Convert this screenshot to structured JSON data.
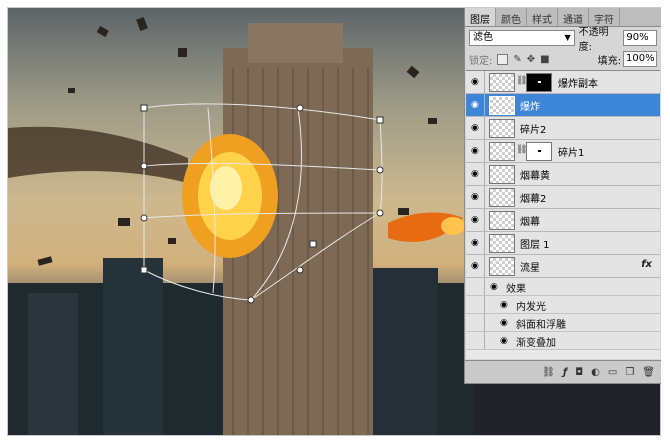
{
  "panel": {
    "tabs": [
      "图层",
      "颜色",
      "样式",
      "通道",
      "字符"
    ],
    "active_tab": "图层",
    "blend_mode": "滤色",
    "opacity_label": "不透明度:",
    "opacity_value": "90%",
    "lock_label": "锁定:",
    "fill_label": "填充:",
    "fill_value": "100%",
    "layers": [
      {
        "name": "爆炸副本",
        "mask": "black",
        "selected": false
      },
      {
        "name": "爆炸",
        "mask": null,
        "selected": true
      },
      {
        "name": "碎片2",
        "mask": null,
        "selected": false
      },
      {
        "name": "碎片1",
        "mask": "white",
        "selected": false
      },
      {
        "name": "烟幕黄",
        "mask": null,
        "selected": false
      },
      {
        "name": "烟幕2",
        "mask": null,
        "selected": false
      },
      {
        "name": "烟幕",
        "mask": null,
        "selected": false
      },
      {
        "name": "图层 1",
        "mask": null,
        "selected": false
      },
      {
        "name": "流星",
        "mask": null,
        "selected": false,
        "fx": "fx"
      }
    ],
    "effects_label": "效果",
    "effects": [
      "内发光",
      "斜面和浮雕",
      "渐变叠加"
    ],
    "bottom_icons": [
      "link-icon",
      "fx-icon",
      "mask-icon",
      "adjustment-icon",
      "group-icon",
      "new-layer-icon",
      "trash-icon"
    ]
  },
  "colors": {
    "selection": "#3d85d6",
    "panel_bg": "#d6d6d6"
  }
}
